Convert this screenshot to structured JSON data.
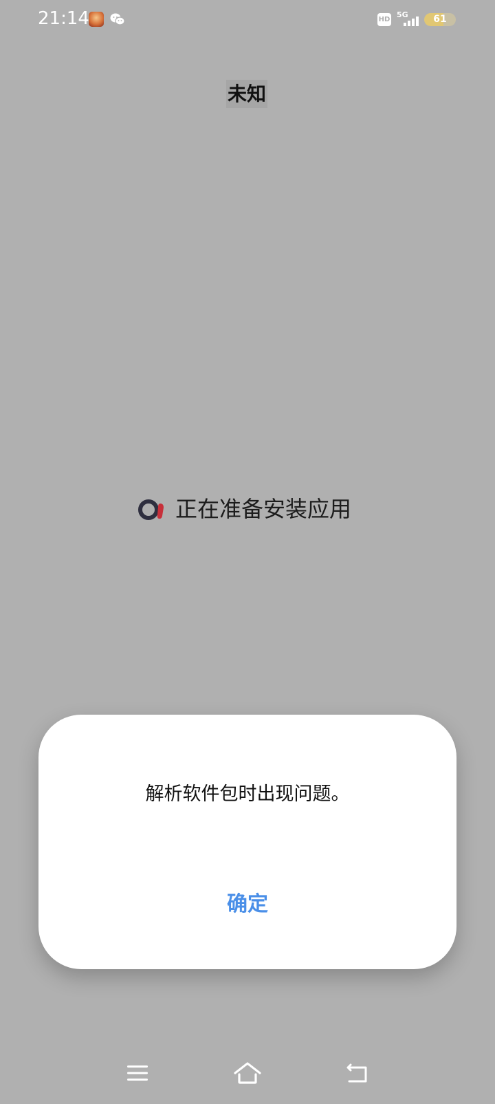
{
  "status_bar": {
    "time": "21:14",
    "hd": "HD",
    "network": "5G",
    "battery_level": 61,
    "battery_label": "61"
  },
  "app": {
    "title": "未知",
    "loading_text": "正在准备安装应用"
  },
  "dialog": {
    "message": "解析软件包时出现问题。",
    "confirm_label": "确定",
    "accent_color": "#4a8fe8"
  },
  "nav_bar": {
    "icons": [
      "menu-icon",
      "home-icon",
      "back-icon"
    ]
  }
}
